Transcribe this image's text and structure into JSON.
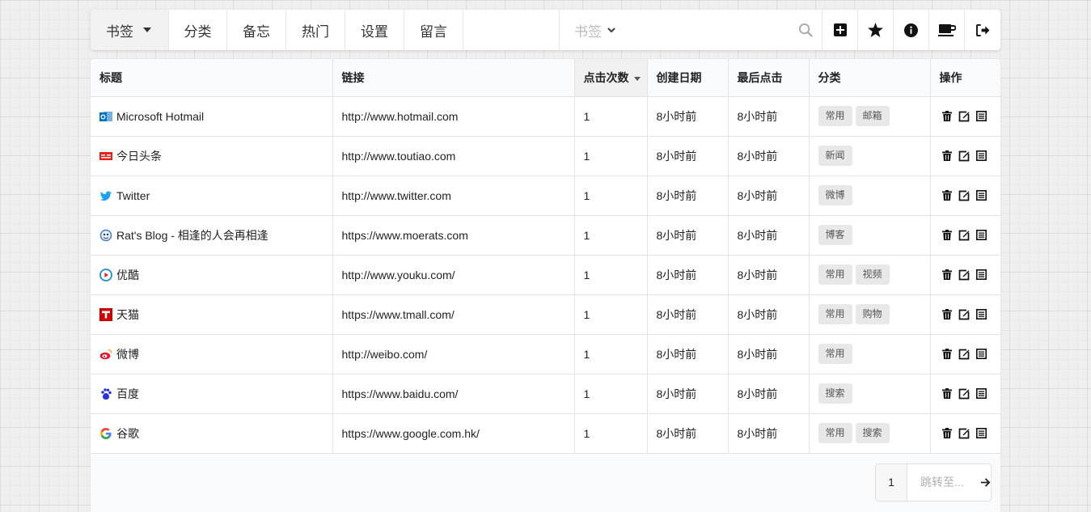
{
  "menu": {
    "items": [
      {
        "label": "书签"
      },
      {
        "label": "分类"
      },
      {
        "label": "备忘"
      },
      {
        "label": "热门"
      },
      {
        "label": "设置"
      },
      {
        "label": "留言"
      }
    ],
    "search": {
      "scope_label": "书签",
      "placeholder": ""
    },
    "icons": [
      "search-icon",
      "add-icon",
      "star-icon",
      "info-icon",
      "coffee-icon",
      "logout-icon"
    ]
  },
  "table": {
    "headers": [
      "标题",
      "链接",
      "点击次数",
      "创建日期",
      "最后点击",
      "分类",
      "操作"
    ],
    "rows": [
      {
        "title": "Microsoft Hotmail",
        "url": "http://www.hotmail.com",
        "clicks": "1",
        "created": "8小时前",
        "last": "8小时前",
        "tags": [
          "常用",
          "邮箱"
        ],
        "icon": "hotmail-icon",
        "icon_color": "#0072c6"
      },
      {
        "title": "今日头条",
        "url": "http://www.toutiao.com",
        "clicks": "1",
        "created": "8小时前",
        "last": "8小时前",
        "tags": [
          "新闻"
        ],
        "icon": "toutiao-icon",
        "icon_color": "#e2231a"
      },
      {
        "title": "Twitter",
        "url": "http://www.twitter.com",
        "clicks": "1",
        "created": "8小时前",
        "last": "8小时前",
        "tags": [
          "微博"
        ],
        "icon": "twitter-icon",
        "icon_color": "#1da1f2"
      },
      {
        "title": "Rat's Blog - 相逢的人会再相逢",
        "url": "https://www.moerats.com",
        "clicks": "1",
        "created": "8小时前",
        "last": "8小时前",
        "tags": [
          "博客"
        ],
        "icon": "blog-icon",
        "icon_color": "#3a7bd5"
      },
      {
        "title": "优酷",
        "url": "http://www.youku.com/",
        "clicks": "1",
        "created": "8小时前",
        "last": "8小时前",
        "tags": [
          "常用",
          "视频"
        ],
        "icon": "youku-icon",
        "icon_color": "#1e88e5"
      },
      {
        "title": "天猫",
        "url": "https://www.tmall.com/",
        "clicks": "1",
        "created": "8小时前",
        "last": "8小时前",
        "tags": [
          "常用",
          "购物"
        ],
        "icon": "tmall-icon",
        "icon_color": "#d00000"
      },
      {
        "title": "微博",
        "url": "http://weibo.com/",
        "clicks": "1",
        "created": "8小时前",
        "last": "8小时前",
        "tags": [
          "常用"
        ],
        "icon": "weibo-icon",
        "icon_color": "#e6162d"
      },
      {
        "title": "百度",
        "url": "https://www.baidu.com/",
        "clicks": "1",
        "created": "8小时前",
        "last": "8小时前",
        "tags": [
          "搜索"
        ],
        "icon": "baidu-icon",
        "icon_color": "#2932e1"
      },
      {
        "title": "谷歌",
        "url": "https://www.google.com.hk/",
        "clicks": "1",
        "created": "8小时前",
        "last": "8小时前",
        "tags": [
          "常用",
          "搜索"
        ],
        "icon": "google-icon",
        "icon_color": "#4285f4"
      }
    ]
  },
  "pager": {
    "page": "1",
    "jump_placeholder": "跳转至..."
  }
}
